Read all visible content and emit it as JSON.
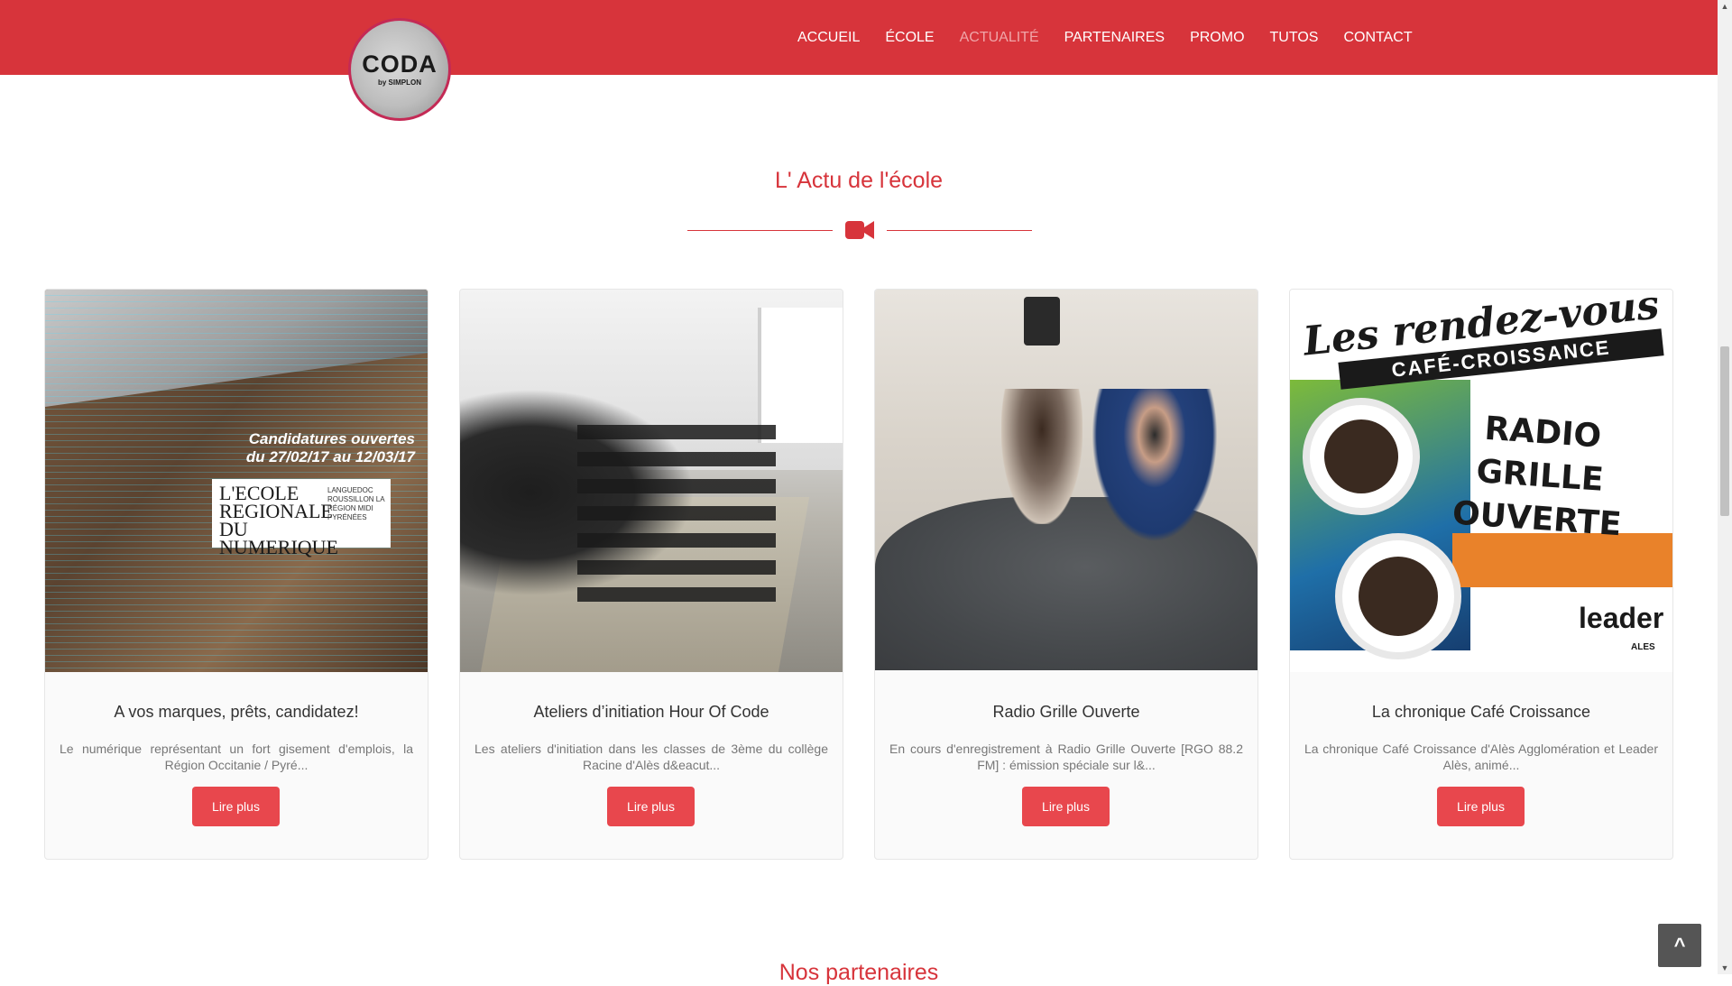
{
  "nav": {
    "logo_text": "CODA",
    "logo_sub": "by SIMPLON",
    "items": [
      "ACCUEIL",
      "ÉCOLE",
      "ACTUALITÉ",
      "PARTENAIRES",
      "PROMO",
      "TUTOS",
      "CONTACT"
    ],
    "active_item": "ACTUALITÉ"
  },
  "section": {
    "title": "L' Actu de l'école",
    "icon": "video-camera-icon",
    "accent_color": "#d7343b"
  },
  "cards": [
    {
      "title": "A vos marques, prêts, candidatez!",
      "text": "Le numérique représentant un fort gisement d'emplois, la Région Occitanie / Pyré...",
      "button": "Lire plus",
      "image": {
        "headline": "Candidatures ouvertes",
        "dates": "du 27/02/17 au 12/03/17",
        "logo_main": "L'ECOLE REGIONALE DU NUMERIQUE",
        "logo_side": "LANGUEDOC ROUSSILLON LA RÉGION MIDI PYRÉNÉES"
      }
    },
    {
      "title": "Ateliers d’initiation Hour Of Code",
      "text": "Les ateliers d'initiation dans les classes de 3ème du collège Racine d'Alès d&eacut...",
      "button": "Lire plus"
    },
    {
      "title": "Radio Grille Ouverte",
      "text": "En cours d'enregistrement à Radio Grille Ouverte [RGO 88.2 FM] : émission spéciale sur l&...",
      "button": "Lire plus"
    },
    {
      "title": "La chronique Café Croissance",
      "text": "La chronique Café Croissance d'Alès Agglomération et Leader Alès, animé...",
      "button": "Lire plus",
      "image": {
        "line1": "Les rendez-vous",
        "line2": "CAFÉ-CROISSANCE",
        "radio": "RADIO GRILLE OUVERTE",
        "brand": "leader",
        "brand_sub": "ALES"
      }
    }
  ],
  "next_section": {
    "title": "Nos partenaires"
  },
  "back_to_top": {
    "label": "^"
  },
  "colors": {
    "navbar": "#d7343b",
    "button": "#e8474d",
    "active_nav": "#f0a5a8"
  }
}
